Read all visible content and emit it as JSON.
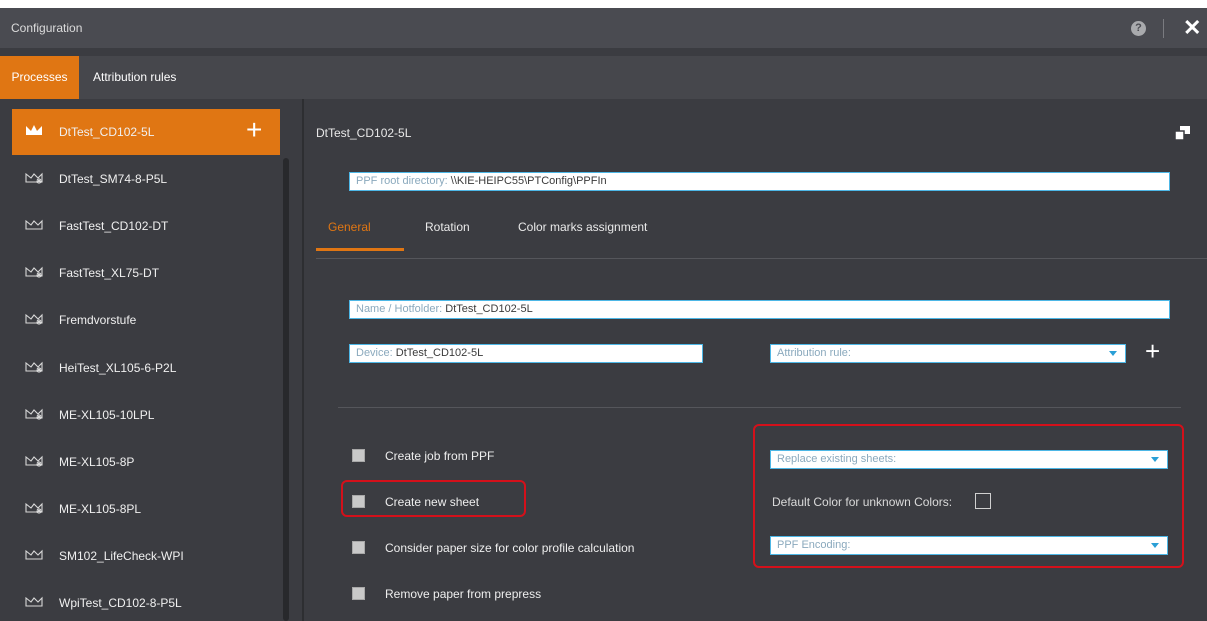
{
  "titlebar": {
    "title": "Configuration",
    "help_icon": "?",
    "close_icon": "✕"
  },
  "top_tabs": [
    {
      "label": "Processes",
      "active": true
    },
    {
      "label": "Attribution rules",
      "active": false
    }
  ],
  "process_list": {
    "add_icon": "+",
    "items": [
      {
        "label": "DtTest_CD102-5L",
        "selected": true,
        "icon": "crown-icon"
      },
      {
        "label": "DtTest_SM74-8-P5L",
        "selected": false,
        "icon": "line-star-icon"
      },
      {
        "label": "FastTest_CD102-DT",
        "selected": false,
        "icon": "line-icon"
      },
      {
        "label": "FastTest_XL75-DT",
        "selected": false,
        "icon": "line-star-icon"
      },
      {
        "label": "Fremdvorstufe",
        "selected": false,
        "icon": "line-star-icon"
      },
      {
        "label": "HeiTest_XL105-6-P2L",
        "selected": false,
        "icon": "line-star-icon"
      },
      {
        "label": "ME-XL105-10LPL",
        "selected": false,
        "icon": "line-star-icon"
      },
      {
        "label": "ME-XL105-8P",
        "selected": false,
        "icon": "line-star-icon"
      },
      {
        "label": "ME-XL105-8PL",
        "selected": false,
        "icon": "line-star-icon"
      },
      {
        "label": "SM102_LifeCheck-WPI",
        "selected": false,
        "icon": "line-icon"
      },
      {
        "label": "WpiTest_CD102-8-P5L",
        "selected": false,
        "icon": "line-icon"
      }
    ]
  },
  "detail": {
    "title": "DtTest_CD102-5L",
    "ppf_root": {
      "label": "PPF root directory:",
      "value": "\\\\KIE-HEIPC55\\PTConfig\\PPFIn"
    },
    "tabs": [
      {
        "label": "General",
        "active": true
      },
      {
        "label": "Rotation",
        "active": false
      },
      {
        "label": "Color marks assignment",
        "active": false
      }
    ],
    "name_hotfolder": {
      "label": "Name / Hotfolder:",
      "value": "DtTest_CD102-5L"
    },
    "device": {
      "label": "Device:",
      "value": "DtTest_CD102-5L"
    },
    "attribution_rule": {
      "placeholder": "Attribution rule:"
    },
    "add_icon": "+",
    "checkboxes": [
      {
        "label": "Create job from PPF",
        "checked": false
      },
      {
        "label": "Create new sheet",
        "checked": false
      },
      {
        "label": "Consider paper size for color profile calculation",
        "checked": false
      },
      {
        "label": "Remove paper from prepress",
        "checked": false
      }
    ],
    "replace_existing_sheets": {
      "placeholder": "Replace existing sheets:"
    },
    "default_color_label": "Default Color for unknown Colors:",
    "ppf_encoding": {
      "placeholder": "PPF Encoding:"
    }
  },
  "colors": {
    "accent": "#e07613",
    "background": "#3b3c41",
    "field_border": "#4db7e6",
    "highlight": "#d4101a"
  }
}
